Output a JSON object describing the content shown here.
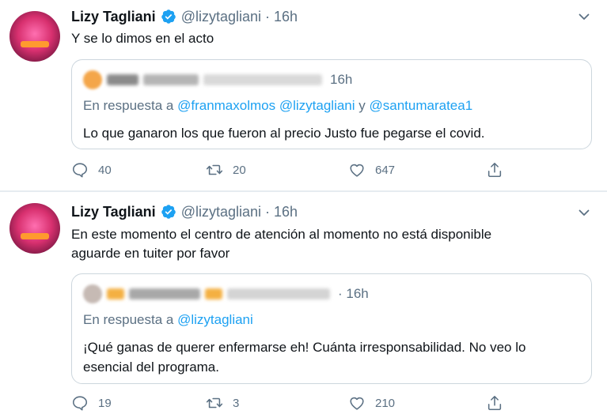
{
  "tweets": [
    {
      "author_name": "Lizy Tagliani",
      "handle": "@lizytagliani",
      "separator": "·",
      "time": "16h",
      "text": "Y se lo dimos en el acto",
      "quote": {
        "time": "16h",
        "reply_prefix": "En respuesta a",
        "mentions": [
          "@franmaxolmos",
          "@lizytagliani"
        ],
        "reply_joiner": "y",
        "last_mention": "@santumaratea1",
        "text": "Lo que ganaron los que fueron al precio Justo fue pegarse el covid."
      },
      "counts": {
        "replies": "40",
        "retweets": "20",
        "likes": "647"
      }
    },
    {
      "author_name": "Lizy Tagliani",
      "handle": "@lizytagliani",
      "separator": "·",
      "time": "16h",
      "text_line1": "En este momento el centro de atención al momento no está disponible",
      "text_line2": "aguarde en tuiter por favor",
      "quote": {
        "time": "· 16h",
        "reply_prefix": "En respuesta a",
        "mention": "@lizytagliani",
        "text_line1": "¡Qué ganas de querer enfermarse eh! Cuánta irresponsabilidad. No veo lo",
        "text_line2": "esencial del programa."
      },
      "counts": {
        "replies": "19",
        "retweets": "3",
        "likes": "210"
      }
    }
  ],
  "icons": {
    "verified": "verified-badge-icon",
    "more": "chevron-down-icon",
    "reply": "reply-icon",
    "retweet": "retweet-icon",
    "like": "heart-icon",
    "share": "share-icon"
  },
  "colors": {
    "accent": "#1da1f2",
    "secondary_text": "#5b7083",
    "primary_text": "#0f1419",
    "border": "#ccd6dd"
  }
}
